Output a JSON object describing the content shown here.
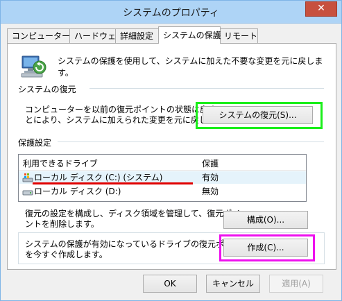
{
  "window": {
    "title": "システムのプロパティ",
    "close_glyph": "✕"
  },
  "tabs": [
    {
      "label": "コンピューター名"
    },
    {
      "label": "ハードウェア"
    },
    {
      "label": "詳細設定"
    },
    {
      "label": "システムの保護"
    },
    {
      "label": "リモート"
    }
  ],
  "intro_text": "システムの保護を使用して、システムに加えた不要な変更を元に戻します。",
  "restore": {
    "heading": "システムの復元",
    "desc_line1": "コンピューターを以前の復元ポイントの状態に戻すこ",
    "desc_line2": "とにより、システムに加えられた変更を元に戻します。",
    "button": "システムの復元(S)..."
  },
  "protection": {
    "heading": "保護設定",
    "columns": {
      "drive": "利用できるドライブ",
      "protection": "保護"
    },
    "rows": [
      {
        "drive": "ローカル ディスク (C:) (システム)",
        "status": "有効",
        "icon": "system-drive-icon"
      },
      {
        "drive": "ローカル ディスク (D:)",
        "status": "無効",
        "icon": "disk-drive-icon"
      }
    ]
  },
  "configure": {
    "desc_line1": "復元の設定を構成し、ディスク領域を管理して、復元ポイ",
    "desc_line2": "ントを削除します。",
    "button": "構成(O)..."
  },
  "create": {
    "desc_line1": "システムの保護が有効になっているドライブの復元ポイント",
    "desc_line2": "を今すぐ作成します。",
    "button": "作成(C)..."
  },
  "footer": {
    "ok": "OK",
    "cancel": "キャンセル",
    "apply": "適用(A)"
  },
  "highlight_colors": {
    "green": "#1aef1a",
    "magenta": "#ee10ee",
    "red": "#e00000"
  }
}
